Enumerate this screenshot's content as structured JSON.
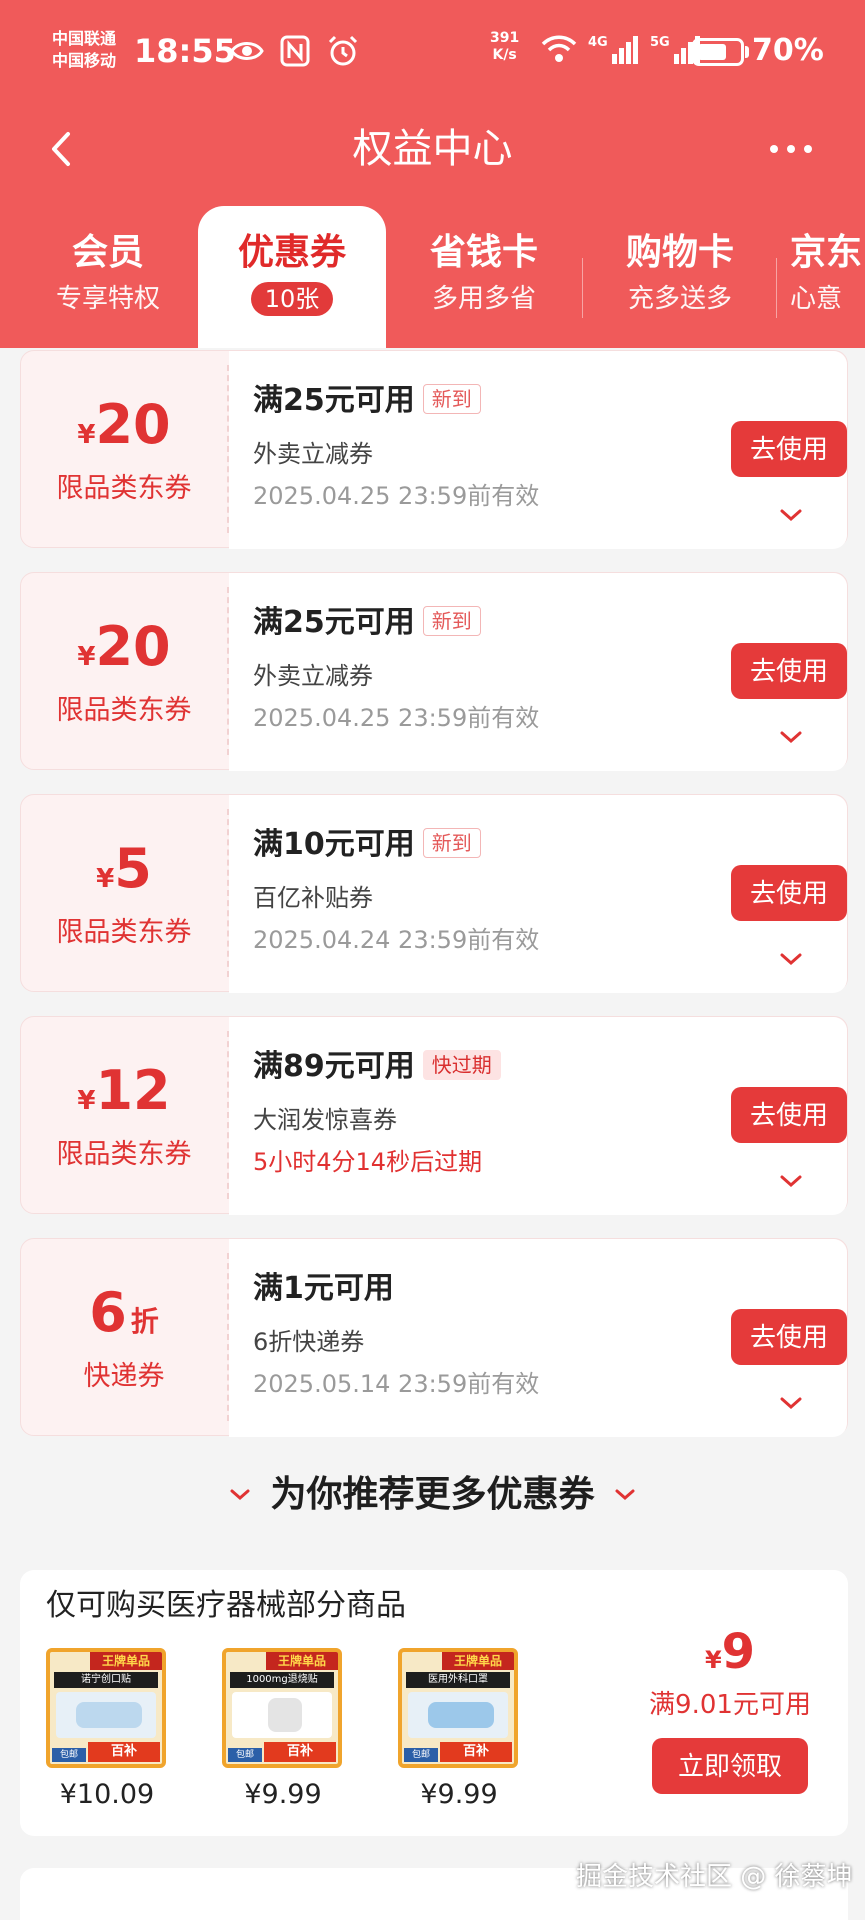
{
  "status_bar": {
    "carrier_1": "中国联通",
    "carrier_2": "中国移动",
    "time": "18:55",
    "net_speed_value": "391",
    "net_speed_unit": "K/s",
    "battery_level": 0.7,
    "battery_text": "70%",
    "network_1": "4G",
    "network_2": "5G"
  },
  "nav": {
    "title": "权益中心"
  },
  "tabs": [
    {
      "label": "会员",
      "sub": "专享特权"
    },
    {
      "label": "优惠券",
      "badge": "10张"
    },
    {
      "label": "省钱卡",
      "sub": "多用多省"
    },
    {
      "label": "购物卡",
      "sub": "充多送多"
    },
    {
      "label": "京东",
      "sub": "心意"
    }
  ],
  "coupons": [
    {
      "currency": "¥",
      "amount": "20",
      "type": "限品类东券",
      "condition": "满25元可用",
      "tag": "新到",
      "name": "外卖立减券",
      "expiry": "2025.04.25 23:59前有效",
      "button": "去使用"
    },
    {
      "currency": "¥",
      "amount": "20",
      "type": "限品类东券",
      "condition": "满25元可用",
      "tag": "新到",
      "name": "外卖立减券",
      "expiry": "2025.04.25 23:59前有效",
      "button": "去使用"
    },
    {
      "currency": "¥",
      "amount": "5",
      "type": "限品类东券",
      "condition": "满10元可用",
      "tag": "新到",
      "name": "百亿补贴券",
      "expiry": "2025.04.24 23:59前有效",
      "button": "去使用"
    },
    {
      "currency": "¥",
      "amount": "12",
      "type": "限品类东券",
      "condition": "满89元可用",
      "tag": "快过期",
      "name": "大润发惊喜券",
      "expiry": "5小时4分14秒后过期",
      "button": "去使用"
    },
    {
      "amount": "6",
      "unit": "折",
      "type": "快递券",
      "condition": "满1元可用",
      "name": "6折快递券",
      "expiry": "2025.05.14 23:59前有效",
      "button": "去使用"
    }
  ],
  "recommend": {
    "title": "为你推荐更多优惠券",
    "card": {
      "title": "仅可购买医疗器械部分商品",
      "products": [
        {
          "price": "¥10.09",
          "brand": "王牌单品",
          "name": "诺宁创口贴",
          "badge": "包邮",
          "promo": "百补"
        },
        {
          "price": "¥9.99",
          "brand": "王牌单品",
          "name": "1000mg退烧贴",
          "badge": "包邮",
          "promo": "百补"
        },
        {
          "price": "¥9.99",
          "brand": "王牌单品",
          "name": "医用外科口罩",
          "badge": "包邮",
          "promo": "百补"
        }
      ],
      "currency": "¥",
      "amount": "9",
      "condition": "满9.01元可用",
      "button": "立即领取"
    }
  },
  "watermark": "掘金技术社区 @ 徐蔡坤",
  "colors": {
    "header_red": "#f05a5a",
    "accent_red": "#e53a3a",
    "coupon_bg": "#fdf2f2"
  }
}
